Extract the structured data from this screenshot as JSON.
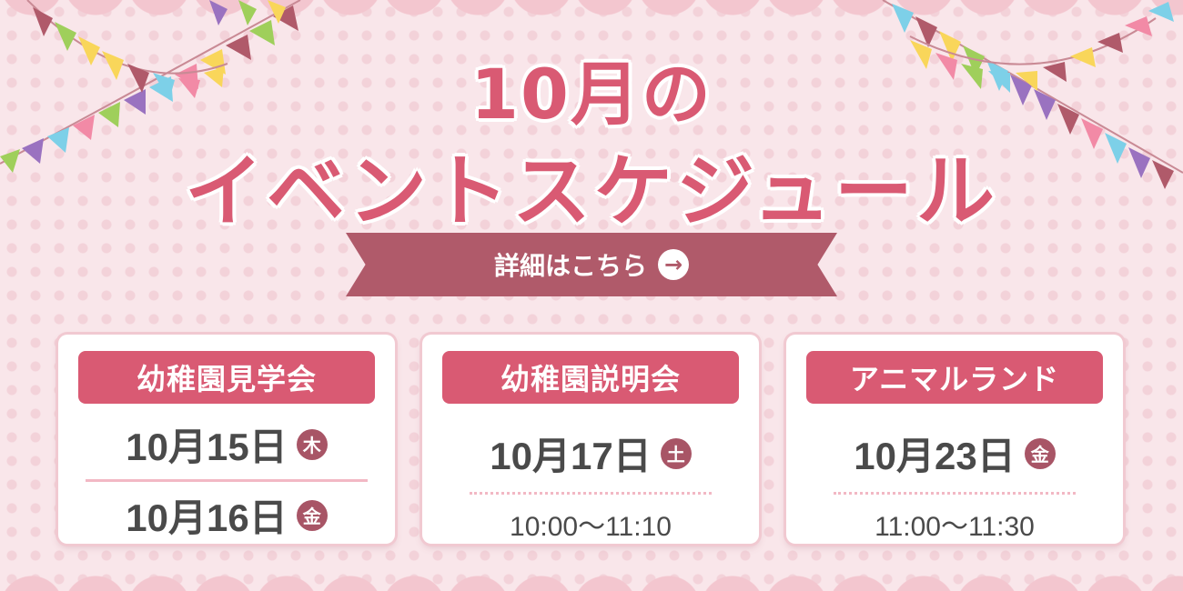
{
  "title": {
    "line1": "10月の",
    "line2": "イベントスケジュール"
  },
  "cta": {
    "label": "詳細はこちら",
    "icon": "arrow-right-circle-icon"
  },
  "events": [
    {
      "name": "幼稚園見学会",
      "dates": [
        {
          "date": "10月15日",
          "day": "木"
        },
        {
          "date": "10月16日",
          "day": "金"
        }
      ]
    },
    {
      "name": "幼稚園説明会",
      "dates": [
        {
          "date": "10月17日",
          "day": "土"
        }
      ],
      "time": "10:00〜11:10"
    },
    {
      "name": "アニマルランド",
      "dates": [
        {
          "date": "10月23日",
          "day": "金"
        }
      ],
      "time": "11:00〜11:30"
    }
  ],
  "colors": {
    "accent": "#d95a73",
    "ribbon": "#b05a6a",
    "background": "#f9e6ea",
    "day_badge": "#a85566"
  }
}
